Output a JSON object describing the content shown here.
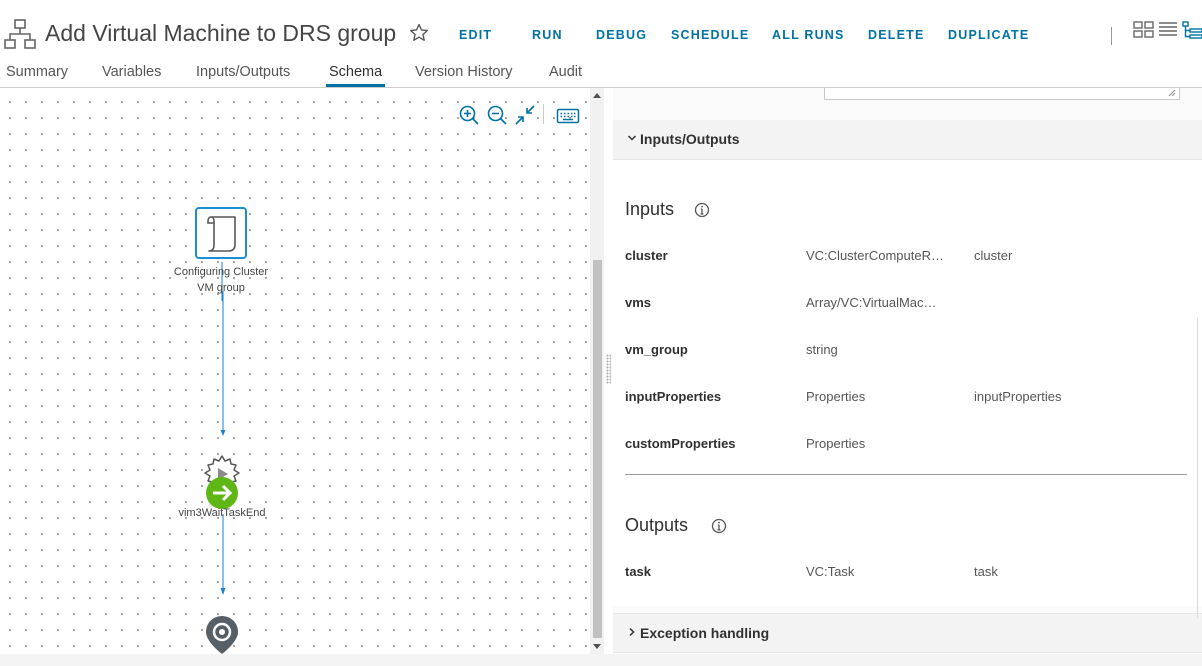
{
  "header": {
    "title": "Add Virtual Machine to DRS group",
    "actions": [
      "EDIT",
      "RUN",
      "DEBUG",
      "SCHEDULE",
      "ALL RUNS",
      "DELETE",
      "DUPLICATE"
    ],
    "tabs": [
      "Summary",
      "Variables",
      "Inputs/Outputs",
      "Schema",
      "Version History",
      "Audit"
    ],
    "active_tab": "Schema"
  },
  "canvas": {
    "nodes": [
      {
        "label_line1": "Configuring Cluster",
        "label_line2": "VM group",
        "icon": "script-scroll-icon"
      },
      {
        "label": "vim3WaitTaskEnd",
        "icon": "gear-action-icon"
      },
      {
        "icon": "end-pin-icon"
      }
    ],
    "toolbar_icons": [
      "zoom-in-icon",
      "zoom-out-icon",
      "fit-to-screen-icon",
      "keyboard-icon"
    ]
  },
  "panel": {
    "inputs_outputs_section": "Inputs/Outputs",
    "inputs_title": "Inputs",
    "inputs": [
      {
        "name": "cluster",
        "type": "VC:ClusterComputeR…",
        "binding": "cluster"
      },
      {
        "name": "vms",
        "type": "Array/VC:VirtualMac…",
        "binding": ""
      },
      {
        "name": "vm_group",
        "type": "string",
        "binding": ""
      },
      {
        "name": "inputProperties",
        "type": "Properties",
        "binding": "inputProperties"
      },
      {
        "name": "customProperties",
        "type": "Properties",
        "binding": ""
      }
    ],
    "outputs_title": "Outputs",
    "outputs": [
      {
        "name": "task",
        "type": "VC:Task",
        "binding": "task"
      }
    ],
    "exception_section": "Exception handling"
  },
  "colors": {
    "accent": "#0072a3",
    "action_green": "#5eb715",
    "pin_gray": "#565f66"
  }
}
